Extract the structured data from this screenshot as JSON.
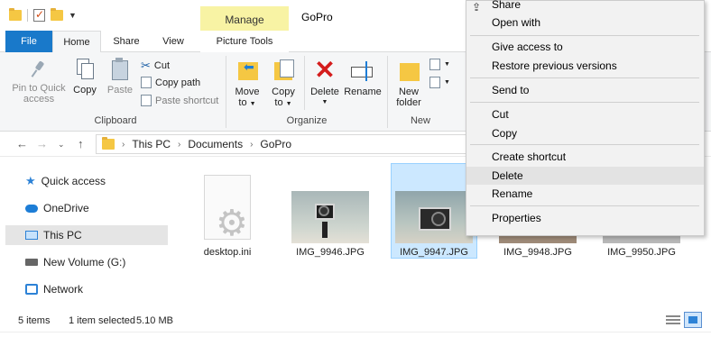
{
  "window": {
    "title": "GoPro",
    "contextual_tab_group": "Manage"
  },
  "tabs": [
    {
      "label": "File"
    },
    {
      "label": "Home"
    },
    {
      "label": "Share"
    },
    {
      "label": "View"
    },
    {
      "label": "Picture Tools"
    }
  ],
  "ribbon": {
    "clipboard": {
      "pin_label": "Pin to Quick access",
      "pin_line1": "Pin to Quick",
      "pin_line2": "access",
      "copy": "Copy",
      "paste": "Paste",
      "cut": "Cut",
      "copy_path": "Copy path",
      "paste_shortcut": "Paste shortcut",
      "group": "Clipboard"
    },
    "organize": {
      "move_line1": "Move",
      "move_line2": "to",
      "copy_line1": "Copy",
      "copy_line2": "to",
      "delete": "Delete",
      "rename": "Rename",
      "group": "Organize"
    },
    "new": {
      "newfolder_line1": "New",
      "newfolder_line2": "folder",
      "group": "New"
    }
  },
  "address": {
    "crumbs": [
      "This PC",
      "Documents",
      "GoPro"
    ]
  },
  "nav": [
    {
      "label": "Quick access",
      "icon": "star-icon"
    },
    {
      "label": "OneDrive",
      "icon": "cloud-icon"
    },
    {
      "label": "This PC",
      "icon": "computer-icon",
      "selected": true
    },
    {
      "label": "New Volume (G:)",
      "icon": "drive-icon"
    },
    {
      "label": "Network",
      "icon": "network-icon"
    }
  ],
  "files": [
    {
      "name": "desktop.ini",
      "type": "ini"
    },
    {
      "name": "IMG_9946.JPG",
      "type": "jpg"
    },
    {
      "name": "IMG_9947.JPG",
      "type": "jpg",
      "selected": true
    },
    {
      "name": "IMG_9948.JPG",
      "type": "jpg"
    },
    {
      "name": "IMG_9950.JPG",
      "type": "jpg"
    }
  ],
  "context_menu": {
    "items": [
      {
        "label": "Share"
      },
      {
        "label": "Open with"
      },
      {
        "label": "Give access to"
      },
      {
        "label": "Restore previous versions"
      },
      {
        "label": "Send to"
      },
      {
        "label": "Cut"
      },
      {
        "label": "Copy"
      },
      {
        "label": "Create shortcut"
      },
      {
        "label": "Delete",
        "highlighted": true
      },
      {
        "label": "Rename"
      },
      {
        "label": "Properties"
      }
    ]
  },
  "status": {
    "count": "5 items",
    "selected": "1 item selected",
    "size": "5.10 MB"
  },
  "colors": {
    "file_tab": "#1979ca",
    "contextual_tab": "#f8f3a4",
    "selection": "#cce8ff",
    "delete_icon": "#d41c1c"
  }
}
